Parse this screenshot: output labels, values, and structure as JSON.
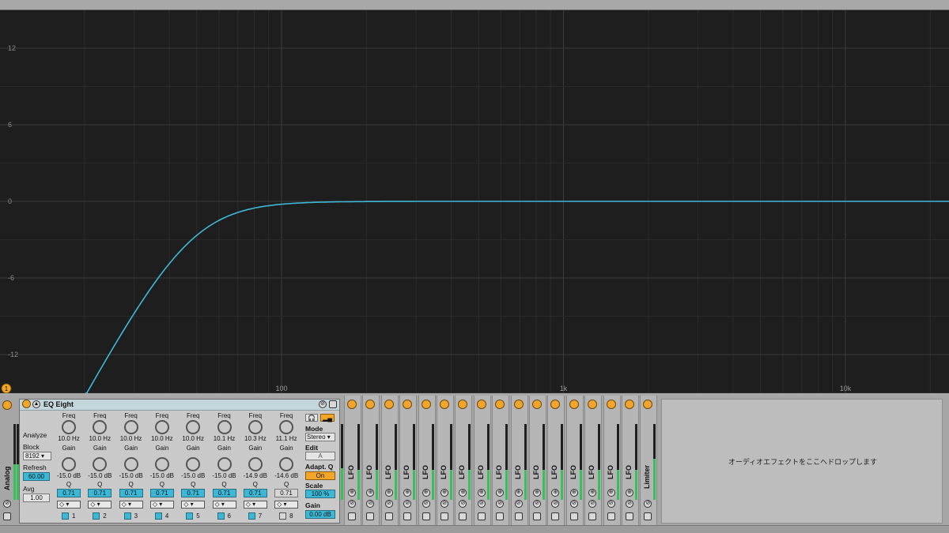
{
  "display": {
    "y_ticks": [
      "12",
      "6",
      "0",
      "-6",
      "-12"
    ],
    "x_ticks": [
      "100",
      "1k",
      "10k"
    ],
    "curve_color": "#3fb8d6",
    "marker_label": "1"
  },
  "left_device": {
    "label": "Analog"
  },
  "eq": {
    "title": "EQ Eight",
    "analyze": "Analyze",
    "block_label": "Block",
    "block_value": "8192",
    "refresh_label": "Refresh",
    "refresh_value": "60.00",
    "avg_label": "Avg",
    "avg_value": "1.00",
    "freq_label": "Freq",
    "gain_label": "Gain",
    "q_label": "Q",
    "bands": [
      {
        "freq": "10.0 Hz",
        "gain": "-15.0 dB",
        "q": "0.71",
        "num": "1",
        "active": true
      },
      {
        "freq": "10.0 Hz",
        "gain": "-15.0 dB",
        "q": "0.71",
        "num": "2",
        "active": true
      },
      {
        "freq": "10.0 Hz",
        "gain": "-15.0 dB",
        "q": "0.71",
        "num": "3",
        "active": true
      },
      {
        "freq": "10.0 Hz",
        "gain": "-15.0 dB",
        "q": "0.71",
        "num": "4",
        "active": true
      },
      {
        "freq": "10.0 Hz",
        "gain": "-15.0 dB",
        "q": "0.71",
        "num": "5",
        "active": true
      },
      {
        "freq": "10.1 Hz",
        "gain": "-15.0 dB",
        "q": "0.71",
        "num": "6",
        "active": true
      },
      {
        "freq": "10.3 Hz",
        "gain": "-14.9 dB",
        "q": "0.71",
        "num": "7",
        "active": true
      },
      {
        "freq": "11.1 Hz",
        "gain": "-14.6 dB",
        "q": "0.71",
        "num": "8",
        "active": false
      }
    ],
    "mode_label": "Mode",
    "mode_value": "Stereo",
    "edit_label": "Edit",
    "edit_value": "A",
    "adaptq_label": "Adapt. Q",
    "adaptq_value": "On",
    "scale_label": "Scale",
    "scale_value": "100 %",
    "gain_out_label": "Gain",
    "gain_out_value": "0.00 dB"
  },
  "lfo_label": "LFO",
  "limiter_label": "Limiter",
  "dropzone_text": "オーディオエフェクトをここへドロップします"
}
